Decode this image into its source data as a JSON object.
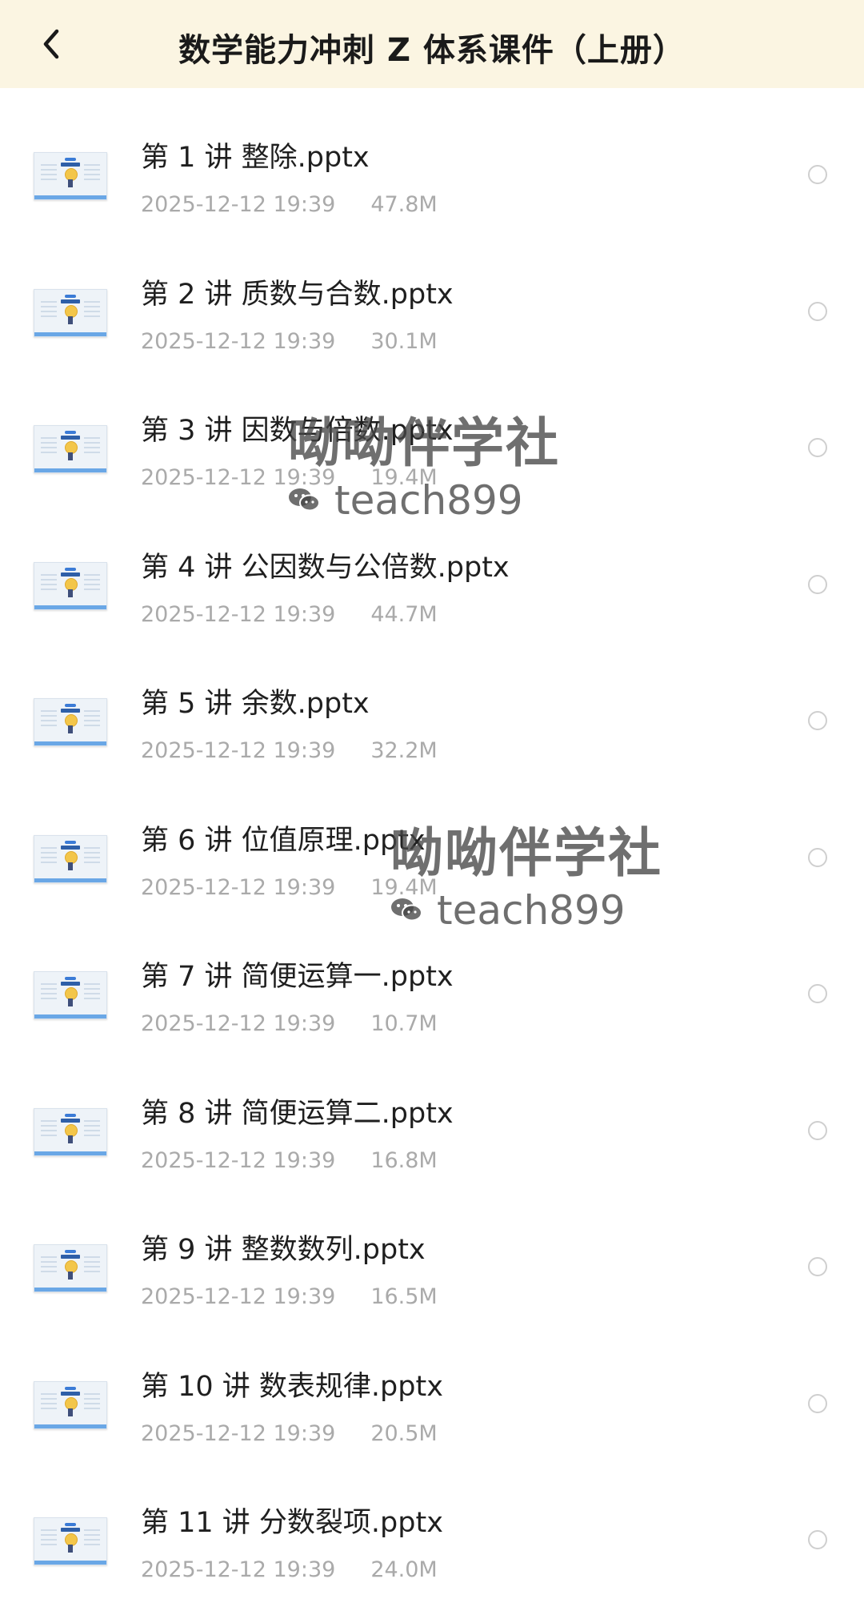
{
  "header": {
    "title": "数学能力冲刺 Z 体系课件（上册）"
  },
  "files": [
    {
      "name": "第 1 讲 整除.pptx",
      "date": "2025-12-12 19:39",
      "size": "47.8M"
    },
    {
      "name": "第 2 讲 质数与合数.pptx",
      "date": "2025-12-12 19:39",
      "size": "30.1M"
    },
    {
      "name": "第 3 讲 因数与倍数.pptx",
      "date": "2025-12-12 19:39",
      "size": "19.4M"
    },
    {
      "name": "第 4 讲 公因数与公倍数.pptx",
      "date": "2025-12-12 19:39",
      "size": "44.7M"
    },
    {
      "name": "第 5 讲 余数.pptx",
      "date": "2025-12-12 19:39",
      "size": "32.2M"
    },
    {
      "name": "第 6 讲 位值原理.pptx",
      "date": "2025-12-12 19:39",
      "size": "19.4M"
    },
    {
      "name": "第 7 讲 简便运算一.pptx",
      "date": "2025-12-12 19:39",
      "size": "10.7M"
    },
    {
      "name": "第 8 讲 简便运算二.pptx",
      "date": "2025-12-12 19:39",
      "size": "16.8M"
    },
    {
      "name": "第 9 讲 整数数列.pptx",
      "date": "2025-12-12 19:39",
      "size": "16.5M"
    },
    {
      "name": "第 10 讲 数表规律.pptx",
      "date": "2025-12-12 19:39",
      "size": "20.5M"
    },
    {
      "name": "第 11 讲 分数裂项.pptx",
      "date": "2025-12-12 19:39",
      "size": "24.0M"
    }
  ],
  "watermarks": [
    {
      "text": "呦呦伴学社",
      "sub": "teach899"
    },
    {
      "text": "呦呦伴学社",
      "sub": "teach899"
    }
  ]
}
